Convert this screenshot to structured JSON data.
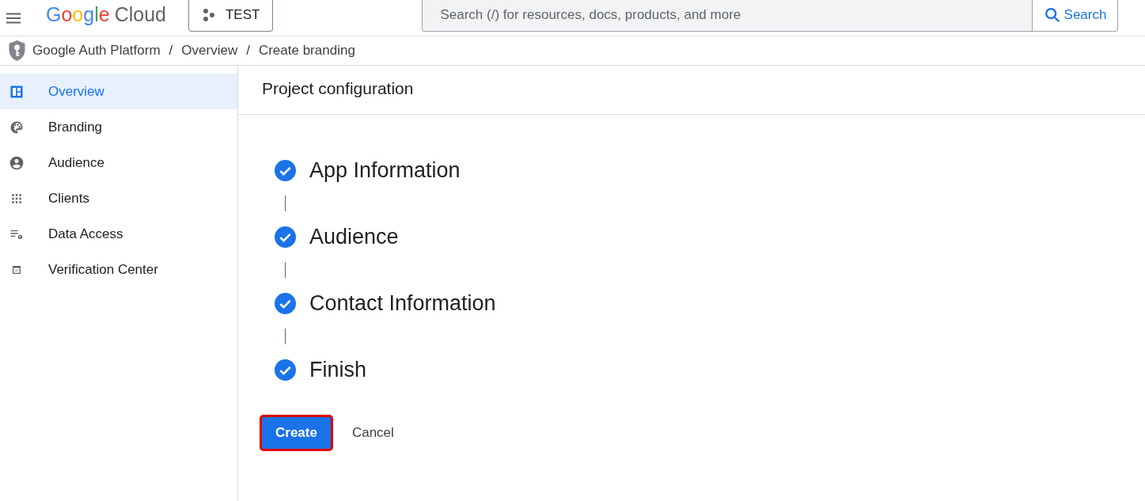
{
  "header": {
    "logo_brand": "Google",
    "logo_product": "Cloud",
    "project": "TEST",
    "search": {
      "placeholder": "Search (/) for resources, docs, products, and more",
      "button": "Search"
    }
  },
  "breadcrumb": [
    "Google Auth Platform",
    "Overview",
    "Create branding"
  ],
  "breadcrumb_separators": [
    "/",
    "/"
  ],
  "sidebar": {
    "items": [
      {
        "label": "Overview",
        "selected": true
      },
      {
        "label": "Branding",
        "selected": false
      },
      {
        "label": "Audience",
        "selected": false
      },
      {
        "label": "Clients",
        "selected": false
      },
      {
        "label": "Data Access",
        "selected": false
      },
      {
        "label": "Verification Center",
        "selected": false
      }
    ]
  },
  "main": {
    "title": "Project configuration",
    "steps": [
      {
        "label": "App Information",
        "completed": true
      },
      {
        "label": "Audience",
        "completed": true
      },
      {
        "label": "Contact Information",
        "completed": true
      },
      {
        "label": "Finish",
        "completed": true
      }
    ],
    "buttons": [
      {
        "label": "Create",
        "kind": "primary",
        "highlighted": true
      },
      {
        "label": "Cancel",
        "kind": "text",
        "highlighted": false
      }
    ]
  }
}
